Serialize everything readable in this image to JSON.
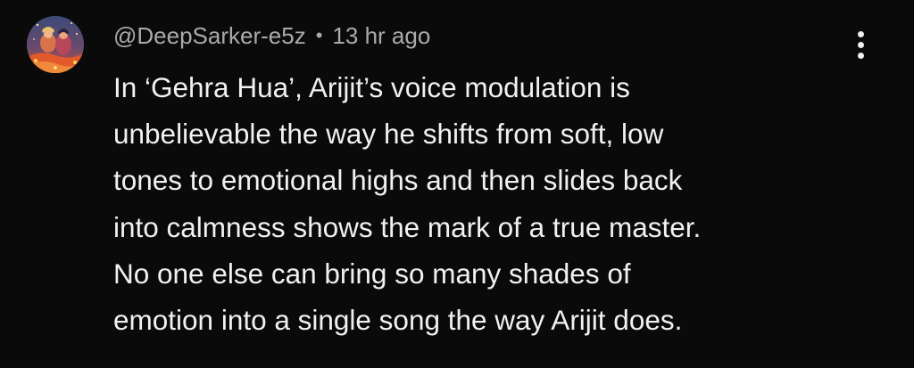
{
  "comment": {
    "author": "@DeepSarker-e5z",
    "separator": "•",
    "timestamp": "13 hr ago",
    "text_lines": [
      "In ‘Gehra Hua’, Arijit’s voice modulation is",
      "unbelievable the way he shifts from soft, low",
      "tones to emotional highs and then slides back",
      "into calmness shows the mark of a true master.",
      "No one else can bring so many shades of",
      "emotion into a single song the way Arijit does."
    ]
  },
  "icons": {
    "menu": "more-vertical-icon"
  },
  "colors": {
    "background": "#0a0a0a",
    "text_primary": "#f1f1f1",
    "text_secondary": "#aaaaaa"
  }
}
